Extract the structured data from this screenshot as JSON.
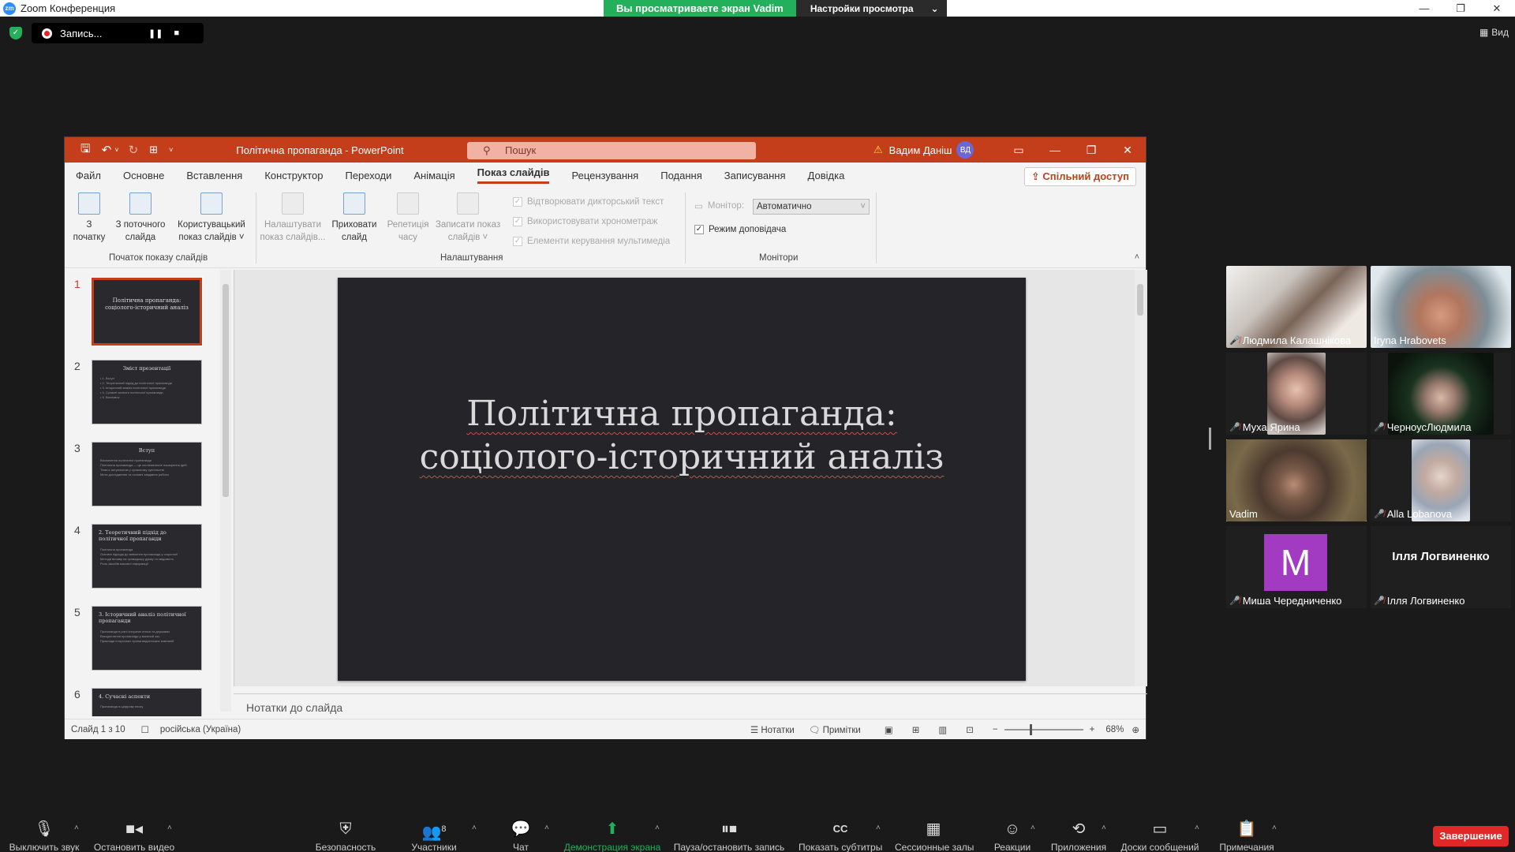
{
  "zoom": {
    "title": "Zoom Конференция",
    "viewing_banner": "Вы просматриваете экран Vadim",
    "view_options": "Настройки просмотра",
    "recording_label": "Запись...",
    "view_button": "Вид",
    "end_button": "Завершение"
  },
  "ppt": {
    "doc_title": "Політична пропаганда  -  PowerPoint",
    "search_placeholder": "Пошук",
    "user_name": "Вадим Даніш",
    "user_initials": "ВД",
    "share_button": "Спільний доступ",
    "menu": [
      "Файл",
      "Основне",
      "Вставлення",
      "Конструктор",
      "Переходи",
      "Анімація",
      "Показ слайдів",
      "Рецензування",
      "Подання",
      "Записування",
      "Довідка"
    ],
    "active_menu": "Показ слайдів",
    "ribbon": {
      "from_start": "З\nпочатку",
      "from_current": "З поточного\nслайда",
      "custom_show": "Користувацький\nпоказ слайдів ˅",
      "setup_show": "Налаштувати\nпоказ слайдів...",
      "hide_slide": "Приховати\nслайд",
      "rehearse": "Репетиція\nчасу",
      "record_show": "Записати показ\nслайдів ˅",
      "cb_narration": "Відтворювати дикторський текст",
      "cb_timings": "Використовувати хронометраж",
      "cb_media": "Елементи керування мультимедіа",
      "monitor_label": "Монітор:",
      "monitor_value": "Автоматично",
      "presenter_view": "Режим доповідача",
      "group_start": "Початок показу слайдів",
      "group_setup": "Налаштування",
      "group_monitors": "Монітори"
    },
    "thumbnails": [
      {
        "num": "1",
        "title": "Політична пропаганда: соціолого-історичний аналіз",
        "lines": []
      },
      {
        "num": "2",
        "title": "Зміст презентації",
        "lines": [
          "• 1. Вступ",
          "• 2. Теоретичний підхід до політичної пропаганди",
          "• 3. Історичний аналіз політичної пропаганди",
          "• 4. Сучасні аспекти політичної пропаганди",
          "• 5. Висновок"
        ]
      },
      {
        "num": "3",
        "title": "Вступ",
        "lines": [
          "Визначення політичної пропаганди",
          "Політична пропаганда — це систематичне поширення ідей",
          "Тема є актуальною у сучасному суспільстві",
          "Мета дослідження та основні завдання роботи"
        ]
      },
      {
        "num": "4",
        "title": "2. Теоретичний підхід до політичної пропаганди",
        "lines": [
          "Політична пропаганда",
          "Основні підходи до вивчення пропаганди у соціології",
          "Методи впливу на громадську думку та свідомість",
          "Роль засобів масової інформації"
        ]
      },
      {
        "num": "5",
        "title": "3. Історичний аналіз політичної пропаганди",
        "lines": [
          "Пропаганда в різні історичні епохи та державах",
          "Використання пропаганди у воєнний час",
          "Приклади історичних пропагандистських кампаній"
        ]
      },
      {
        "num": "6",
        "title": "4. Сучасні аспекти",
        "lines": [
          "Пропаганда в цифрову епоху"
        ]
      }
    ],
    "slide_title": "Політична пропаганда: соціолого-історичний аналіз",
    "notes_placeholder": "Нотатки до слайда",
    "status": {
      "slide_info": "Слайд 1 з 10",
      "language": "російська (Україна)",
      "notes_btn": "Нотатки",
      "comments_btn": "Примітки",
      "zoom_level": "68%"
    }
  },
  "participants": [
    {
      "name": "Людмила Калашнікова",
      "muted": true
    },
    {
      "name": "Iryna Hrabovets",
      "muted": false
    },
    {
      "name": "Муха Ярина",
      "muted": true
    },
    {
      "name": "ЧерноусЛюдмила",
      "muted": true
    },
    {
      "name": "Vadim",
      "muted": false
    },
    {
      "name": "Alla Lobanova",
      "muted": true
    },
    {
      "name": "Миша Чередниченко",
      "muted": true,
      "avatar_letter": "M"
    },
    {
      "name": "Ілля Логвиненко",
      "muted": true,
      "big_name": "Ілля Логвиненко"
    }
  ],
  "toolbar": {
    "mute": "Выключить звук",
    "video": "Остановить видео",
    "security": "Безопасность",
    "participants": "Участники",
    "participants_count": "8",
    "chat": "Чат",
    "share": "Демонстрация экрана",
    "pause_rec": "Пауза/остановить запись",
    "captions": "Показать субтитры",
    "breakout": "Сессионные залы",
    "reactions": "Реакции",
    "apps": "Приложения",
    "whiteboards": "Доски сообщений",
    "notes": "Примечания"
  },
  "colors": {
    "ppt_accent": "#c43e1c",
    "zoom_green": "#23b05a",
    "end_red": "#e02828",
    "speaker_highlight": "#c7e05a"
  }
}
